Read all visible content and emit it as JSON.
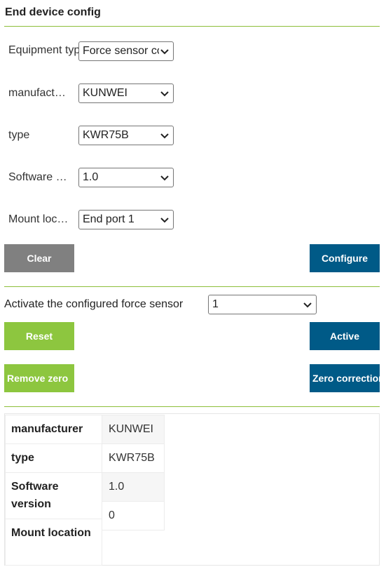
{
  "title": "End device config",
  "form": {
    "rows": [
      {
        "label": "Equipment type",
        "value": "Force sensor config"
      },
      {
        "label": "manufacturer",
        "value": "KUNWEI"
      },
      {
        "label": "type",
        "value": "KWR75B"
      },
      {
        "label": "Software version",
        "value": "1.0"
      },
      {
        "label": "Mount location",
        "value": "End port 1"
      }
    ]
  },
  "buttons": {
    "clear": "Clear",
    "configure": "Configure",
    "reset": "Reset",
    "active": "Active",
    "remove_zero": "Remove zero",
    "zero_correction": "Zero correction"
  },
  "activate": {
    "label": "Activate the configured force sensor",
    "value": "1"
  },
  "info_table": {
    "rows": [
      {
        "key": "manufacturer",
        "value": "KUNWEI"
      },
      {
        "key": "type",
        "value": "KWR75B"
      },
      {
        "key": "Software version",
        "value": "1.0"
      },
      {
        "key": "Mount location",
        "value": "0"
      }
    ]
  },
  "colors": {
    "accent_green": "#8dc63f",
    "primary_blue": "#005a87",
    "neutral_gray": "#808080"
  }
}
